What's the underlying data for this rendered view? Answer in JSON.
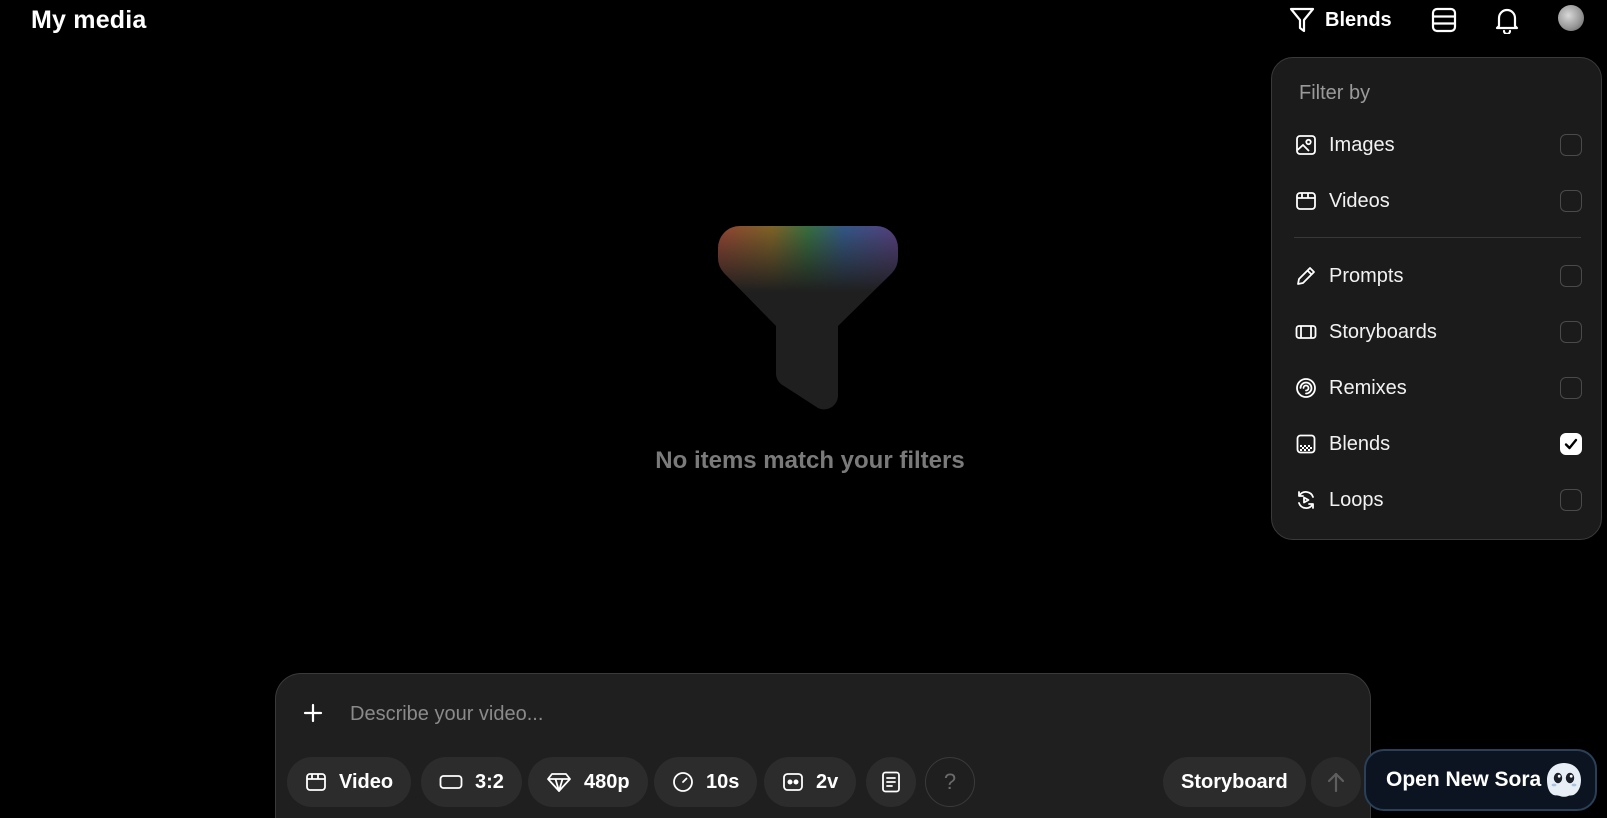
{
  "header": {
    "title": "My media",
    "filter_label": "Blends"
  },
  "empty_state": {
    "message": "No items match your filters"
  },
  "filter_menu": {
    "heading": "Filter by",
    "items": [
      {
        "label": "Images",
        "checked": false
      },
      {
        "label": "Videos",
        "checked": false
      },
      {
        "label": "Prompts",
        "checked": false
      },
      {
        "label": "Storyboards",
        "checked": false
      },
      {
        "label": "Remixes",
        "checked": false
      },
      {
        "label": "Blends",
        "checked": true
      },
      {
        "label": "Loops",
        "checked": false
      }
    ]
  },
  "composer": {
    "placeholder": "Describe your video...",
    "type_label": "Video",
    "aspect_label": "3:2",
    "resolution_label": "480p",
    "duration_label": "10s",
    "variations_label": "2v",
    "help_label": "?",
    "storyboard_label": "Storyboard"
  },
  "promo": {
    "label": "Open New Sora"
  },
  "colors": {
    "background": "#000000",
    "surface": "#1f1f1f",
    "menu": "#1b1b1b",
    "muted_text": "#7a7a7a"
  }
}
